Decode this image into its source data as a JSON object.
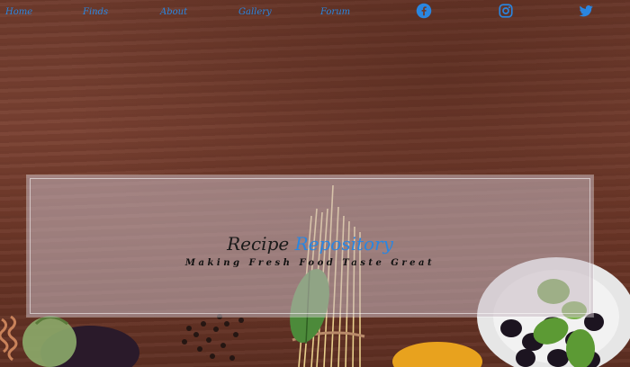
{
  "nav": {
    "links": [
      {
        "label": "Home"
      },
      {
        "label": "Finds"
      },
      {
        "label": "About"
      },
      {
        "label": "Gallery"
      },
      {
        "label": "Forum"
      }
    ],
    "social": [
      {
        "icon": "facebook-icon"
      },
      {
        "icon": "instagram-icon"
      },
      {
        "icon": "twitter-icon"
      }
    ]
  },
  "hero": {
    "title_part1": "Recipe",
    "title_part2": "Repository",
    "tagline": "Making Fresh Food Taste Great"
  },
  "colors": {
    "accent": "#2a86e0",
    "wood": "#6e3a2c"
  }
}
